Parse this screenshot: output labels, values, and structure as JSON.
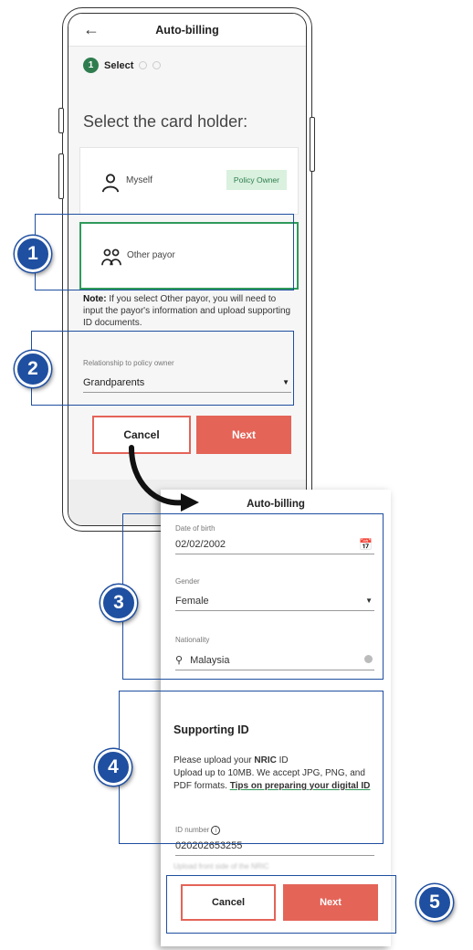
{
  "screen1": {
    "title": "Auto-billing",
    "step_number": "1",
    "step_label": "Select",
    "heading": "Select the card holder:",
    "options": [
      {
        "label": "Myself",
        "badge": "Policy Owner"
      },
      {
        "label": "Other payor"
      }
    ],
    "note_bold": "Note:",
    "note_text": " If you select Other payor, you will need to input the payor's information and upload supporting ID documents.",
    "relationship_label": "Relationship to policy owner",
    "relationship_value": "Grandparents",
    "cancel_label": "Cancel",
    "next_label": "Next"
  },
  "screen2": {
    "title": "Auto-billing",
    "dob_label": "Date of birth",
    "dob_value": "02/02/2002",
    "gender_label": "Gender",
    "gender_value": "Female",
    "nationality_label": "Nationality",
    "nationality_value": "Malaysia",
    "supporting_title": "Supporting ID",
    "upload_text_prefix": "Please upload your ",
    "upload_text_bold": "NRIC",
    "upload_text_suffix": " ID",
    "upload_formats": "Upload up to 10MB. We accept JPG, PNG, and PDF formats. ",
    "tips_link": "Tips on preparing your digital ID",
    "id_label": "ID number",
    "id_value": "020202653255",
    "partial_text": "Upload front side of the NRIC",
    "cancel_label": "Cancel",
    "next_label": "Next"
  },
  "markers": [
    "1",
    "2",
    "3",
    "4",
    "5"
  ],
  "colors": {
    "accent_green": "#2f9a5a",
    "accent_red": "#e46458",
    "marker_blue": "#1f4fa0"
  }
}
